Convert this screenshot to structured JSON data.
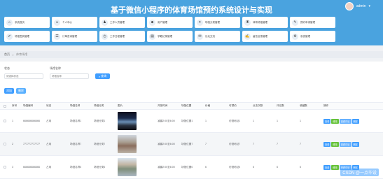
{
  "app": {
    "title": "基于微信小程序的体育场馆预约系统设计与实现",
    "user": "admin",
    "user_caret": "▾"
  },
  "nav": [
    {
      "icon": "home-icon",
      "glyph": "⌂",
      "label": "系统首页"
    },
    {
      "icon": "user-icon",
      "glyph": "☺",
      "label": "个人中心"
    },
    {
      "icon": "staff-icon",
      "glyph": "♟",
      "label": "工作人员管理"
    },
    {
      "icon": "users-icon",
      "glyph": "☻",
      "label": "用户管理"
    },
    {
      "icon": "category-icon",
      "glyph": "✦",
      "label": "场馆分类管理"
    },
    {
      "icon": "venue-icon",
      "glyph": "♜",
      "label": "体育场馆管理"
    },
    {
      "icon": "booking-icon",
      "glyph": "✎",
      "label": "预约申请管理"
    },
    {
      "icon": "signin-icon",
      "glyph": "✔",
      "label": "场馆签到管理"
    },
    {
      "icon": "order-icon",
      "glyph": "☰",
      "label": "订单查询管理"
    },
    {
      "icon": "schedule-icon",
      "glyph": "◷",
      "label": "工作日程管理"
    },
    {
      "icon": "record-icon",
      "glyph": "▤",
      "label": "学籍记录管理"
    },
    {
      "icon": "forum-icon",
      "glyph": "✉",
      "label": "论坛交流"
    },
    {
      "icon": "reply-icon",
      "glyph": "✍",
      "label": "留言反馈管理"
    },
    {
      "icon": "system-icon",
      "glyph": "⚙",
      "label": "系统管理"
    }
  ],
  "breadcrumb": {
    "home": "首页",
    "separator": "/",
    "current": "体育场馆"
  },
  "filters": {
    "status_label": "状态",
    "status_placeholder": "请选择状态",
    "name_label": "场馆名称",
    "name_placeholder": "场馆名称",
    "search_label": "查询"
  },
  "actions": {
    "add": "添加",
    "delete": "删除"
  },
  "table": {
    "headers": [
      "序号",
      "场馆编号",
      "状态",
      "场馆名称",
      "场馆分类",
      "图片",
      "开放时间",
      "场馆位置",
      "价格",
      "可预约",
      "点击次数",
      "评论数",
      "收藏数",
      "操作"
    ],
    "ops": {
      "view": "查看",
      "edit": "修改",
      "comment": "查看评论",
      "delete": "删除"
    },
    "rows": [
      {
        "index": "1",
        "code": "666666666666",
        "status": "占用",
        "name": "场馆名称1",
        "category": "场馆分类1",
        "hours": "凌晨2:00至6:00",
        "location": "场馆位置1",
        "price": "1",
        "available": "访馆地址1",
        "clicks": "1",
        "comments": "1",
        "favorites": "1"
      },
      {
        "index": "2",
        "code": "777777777777",
        "status": "占用",
        "name": "场馆名称7",
        "category": "场馆分类7",
        "hours": "凌晨2:00至6:00",
        "location": "场馆位置7",
        "price": "7",
        "available": "访馆地址7",
        "clicks": "7",
        "comments": "7",
        "favorites": "7"
      },
      {
        "index": "3",
        "code": "666666666666",
        "status": "占用",
        "name": "场馆名称6",
        "category": "场馆分类6",
        "hours": "凌晨2:00至6:00",
        "location": "场馆位置6",
        "price": "6",
        "available": "访馆地址6",
        "clicks": "6",
        "comments": "6",
        "favorites": "6"
      }
    ]
  },
  "watermark": "CSDN @一点毕设"
}
